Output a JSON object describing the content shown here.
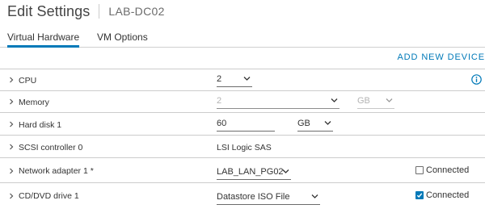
{
  "header": {
    "title": "Edit Settings",
    "vm_name": "LAB-DC02"
  },
  "tabs": [
    {
      "label": "Virtual Hardware",
      "active": true
    },
    {
      "label": "VM Options",
      "active": false
    }
  ],
  "actions": {
    "add_new_device": "ADD NEW DEVICE"
  },
  "hardware": {
    "cpu": {
      "label": "CPU",
      "value": "2",
      "info_icon": "info-icon"
    },
    "memory": {
      "label": "Memory",
      "value": "2",
      "unit": "GB",
      "disabled": true
    },
    "hard_disk": {
      "label": "Hard disk 1",
      "value": "60",
      "unit": "GB"
    },
    "scsi": {
      "label": "SCSI controller 0",
      "value": "LSI Logic SAS"
    },
    "network": {
      "label": "Network adapter 1 *",
      "value": "LAB_LAN_PG02",
      "connected_label": "Connected",
      "connected": false
    },
    "cdrom": {
      "label": "CD/DVD drive 1",
      "value": "Datastore ISO File",
      "connected_label": "Connected",
      "connected": true
    }
  },
  "colors": {
    "accent": "#0079b8",
    "text": "#333333",
    "border": "#cccccc",
    "disabled": "#b3b3b3"
  }
}
